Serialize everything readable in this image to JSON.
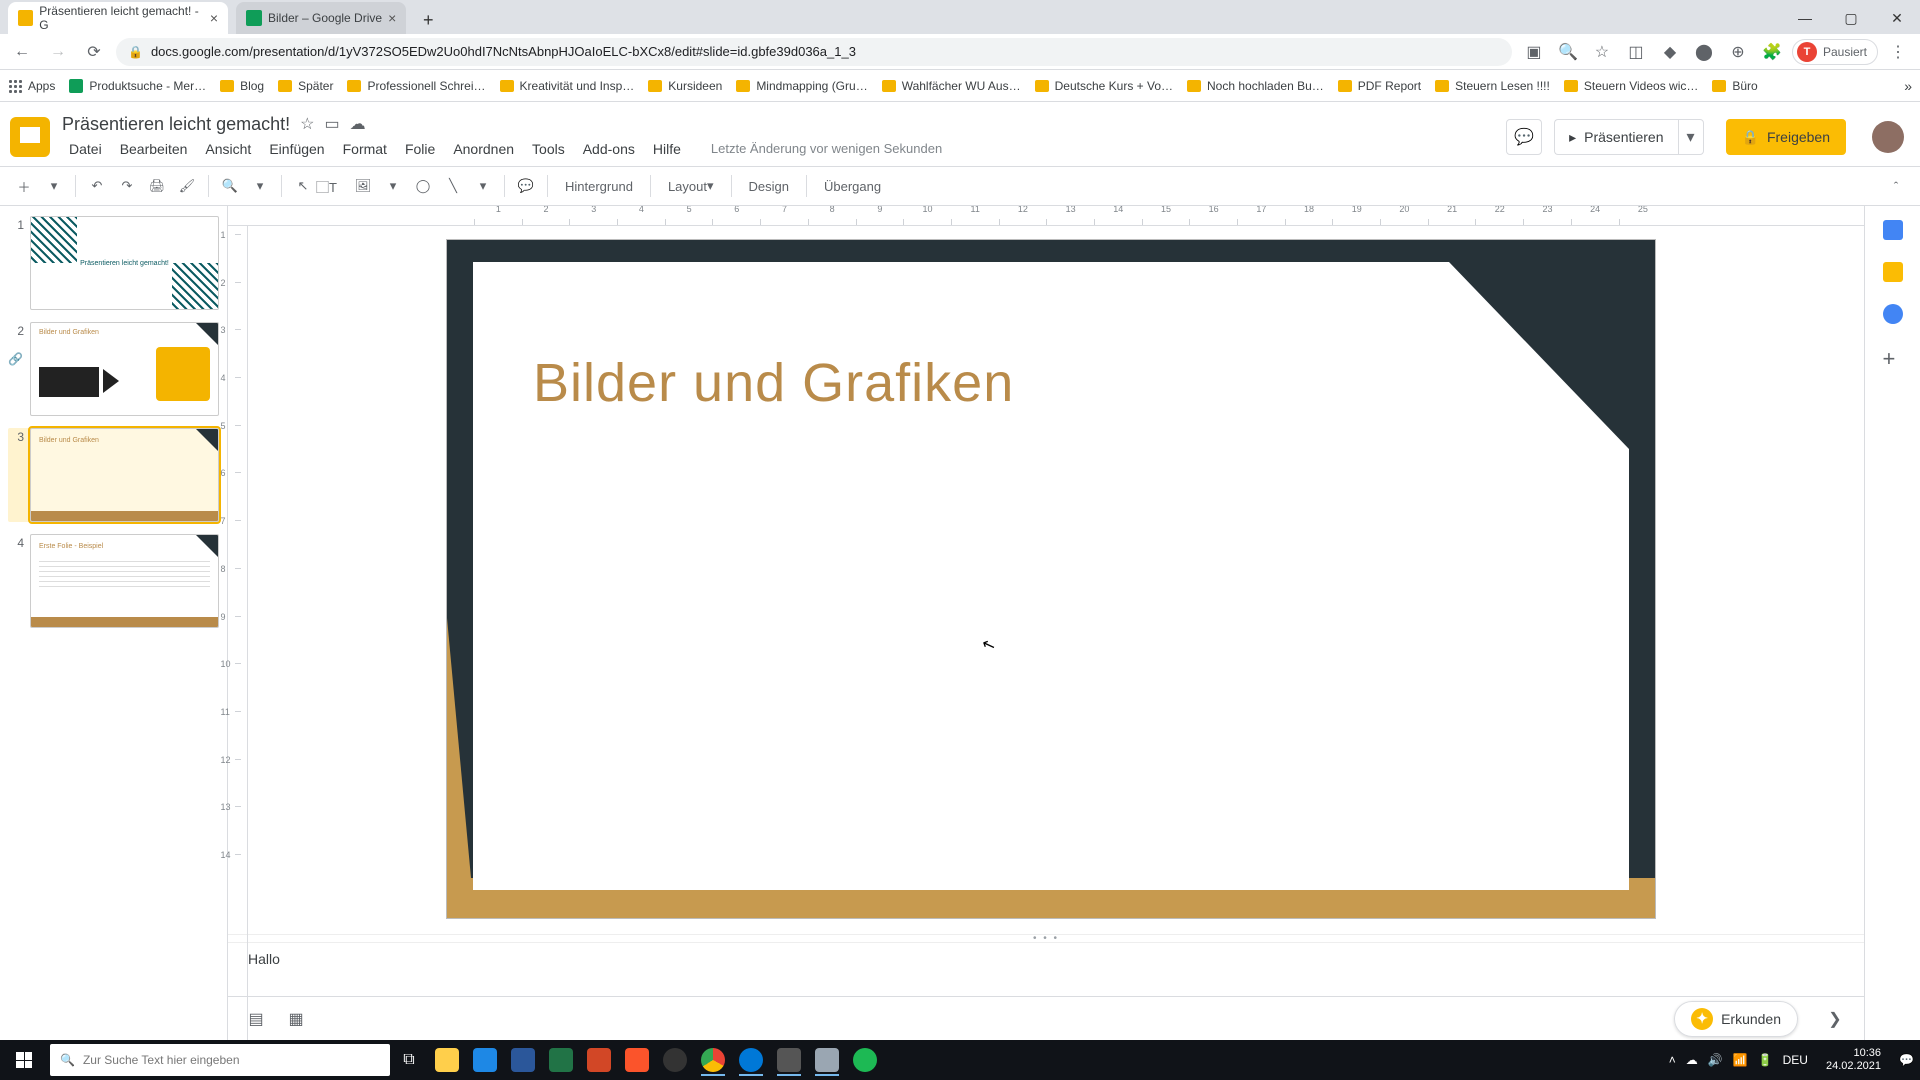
{
  "browser": {
    "tabs": [
      {
        "title": "Präsentieren leicht gemacht! - G",
        "favicon": "slides"
      },
      {
        "title": "Bilder – Google Drive",
        "favicon": "drive"
      }
    ],
    "url": "docs.google.com/presentation/d/1yV372SO5EDw2Uo0hdI7NcNtsAbnpHJOaIoELC-bXCx8/edit#slide=id.gbfe39d036a_1_3",
    "paused_label": "Pausiert",
    "avatar_letter": "T"
  },
  "bookmarks": [
    "Apps",
    "Produktsuche - Mer…",
    "Blog",
    "Später",
    "Professionell Schrei…",
    "Kreativität und Insp…",
    "Kursideen",
    "Mindmapping  (Gru…",
    "Wahlfächer WU Aus…",
    "Deutsche Kurs + Vo…",
    "Noch hochladen Bu…",
    "PDF Report",
    "Steuern Lesen !!!!",
    "Steuern Videos wic…",
    "Büro"
  ],
  "doc": {
    "name": "Präsentieren leicht gemacht!",
    "menus": [
      "Datei",
      "Bearbeiten",
      "Ansicht",
      "Einfügen",
      "Format",
      "Folie",
      "Anordnen",
      "Tools",
      "Add-ons",
      "Hilfe"
    ],
    "last_edit": "Letzte Änderung vor wenigen Sekunden",
    "present_label": "Präsentieren",
    "share_label": "Freigeben"
  },
  "toolbar": {
    "background": "Hintergrund",
    "layout": "Layout",
    "design": "Design",
    "transition": "Übergang"
  },
  "slides": {
    "thumbs": [
      {
        "num": "1",
        "label": "Präsentieren leicht gemacht!"
      },
      {
        "num": "2",
        "label": "Bilder und Grafiken"
      },
      {
        "num": "3",
        "label": "Bilder und Grafiken"
      },
      {
        "num": "4",
        "label": "Erste Folie - Beispiel"
      }
    ],
    "current_title": "Bilder und Grafiken"
  },
  "notes": {
    "text": "Hallo"
  },
  "explore_label": "Erkunden",
  "taskbar": {
    "search_placeholder": "Zur Suche Text hier eingeben",
    "lang": "DEU",
    "time": "10:36",
    "date": "24.02.2021"
  },
  "ruler_h": [
    "1",
    "2",
    "3",
    "4",
    "5",
    "6",
    "7",
    "8",
    "9",
    "10",
    "11",
    "12",
    "13",
    "14",
    "15",
    "16",
    "17",
    "18",
    "19",
    "20",
    "21",
    "22",
    "23",
    "24",
    "25"
  ],
  "ruler_v": [
    "1",
    "2",
    "3",
    "4",
    "5",
    "6",
    "7",
    "8",
    "9",
    "10",
    "11",
    "12",
    "13",
    "14"
  ]
}
